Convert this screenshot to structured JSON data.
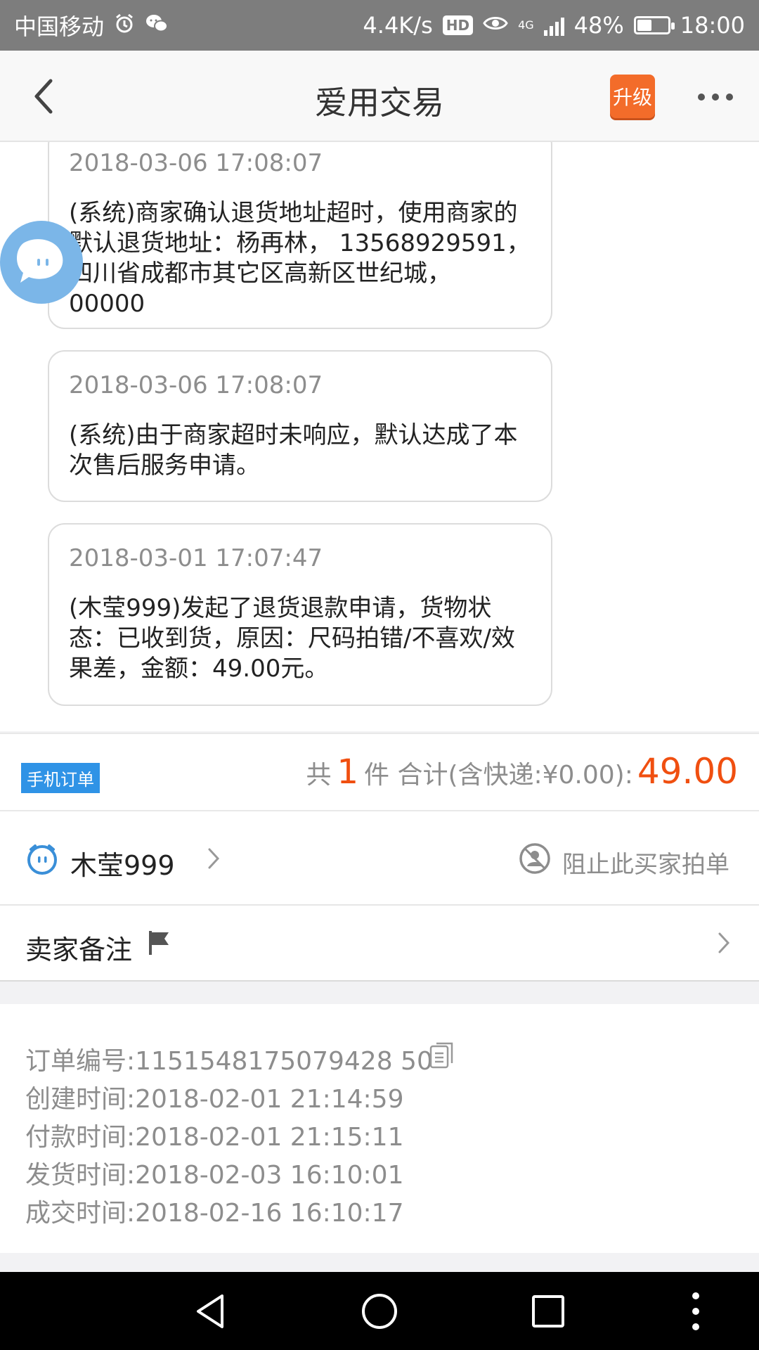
{
  "status_bar": {
    "carrier": "中国移动",
    "net_speed": "4.4K/s",
    "hd": "HD",
    "network": "4G",
    "battery": "48%",
    "battery_level": 0.48,
    "time": "18:00",
    "icons": [
      "alarm-icon",
      "wechat-icon",
      "eye-icon",
      "signal-icon",
      "battery-icon"
    ]
  },
  "header": {
    "title": "爱用交易",
    "upgrade_label": "升级"
  },
  "timeline": [
    {
      "time": "2018-03-06 17:08:07",
      "message": "(系统)商家确认退货地址超时，使用商家的默认退货地址：杨再林， 13568929591， 四川省成都市其它区高新区世纪城， 00000"
    },
    {
      "time": "2018-03-06 17:08:07",
      "message": "(系统)由于商家超时未响应，默认达成了本次售后服务申请。"
    },
    {
      "time": "2018-03-01 17:07:47",
      "message": "(木莹999)发起了退货退款申请，货物状态：已收到货，原因：尺码拍错/不喜欢/效果差，金额：49.00元。"
    }
  ],
  "order_summary": {
    "tag": "手机订单",
    "prefix": "共",
    "count": "1",
    "suffix": "件 合计(含快递:¥0.00):",
    "amount": "49.00"
  },
  "buyer": {
    "name": "木莹999",
    "block_label": "阻止此买家拍单"
  },
  "seller_note": {
    "label": "卖家备注"
  },
  "order_info": {
    "order_no": "订单编号:1151548175079428 50",
    "created": "创建时间:2018-02-01 21:14:59",
    "paid": "付款时间:2018-02-01 21:15:11",
    "shipped": "发货时间:2018-02-03 16:10:01",
    "completed": "成交时间:2018-02-16 16:10:17"
  },
  "colors": {
    "accent_orange": "#f04f10",
    "upgrade_bg": "#f36c2a",
    "tag_blue": "#2f93e6",
    "status_bar_bg": "#7d7d7d"
  }
}
